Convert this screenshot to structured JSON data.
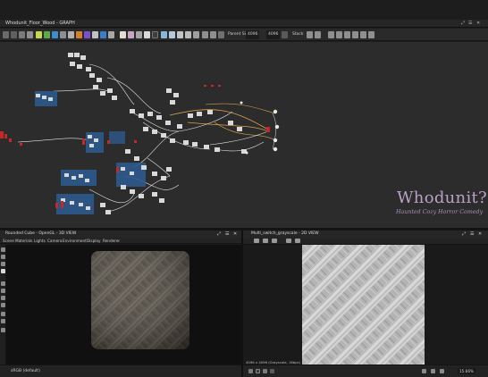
{
  "graph_panel": {
    "title": "Whodunit_Floor_Wood - GRAPH",
    "parent_size_label": "Parent Size:",
    "parent_size_value": "4096",
    "size_value": "4096",
    "blend_label": "Stack",
    "watermark_title": "Whodunit?",
    "watermark_subtitle": "Haunted Cozy Horror Comedy"
  },
  "view3d": {
    "title": "Rounded Cube - OpenGL - 3D VIEW",
    "menu": [
      "Scene",
      "Materials",
      "Lights",
      "Camera",
      "Environment",
      "Display",
      "Renderer"
    ],
    "status_value": "sRGB (default)"
  },
  "view2d": {
    "title": "Multi_switch_grayscale - 2D VIEW",
    "texture_info": "4096 x 4096 (Grayscale, 16bpc)",
    "zoom": "15.66%"
  },
  "colors": {
    "node_blue": "#2e5a8e",
    "node_body": "#d9d9d9",
    "wire_white": "#e8e8e8",
    "wire_orange": "#d9a14a",
    "node_red": "#c62828",
    "watermark": "#b9a0c7"
  },
  "icons": [
    "close-icon",
    "float-icon",
    "menu-icon",
    "camera-icon",
    "grid-icon",
    "zoom-icon",
    "lock-icon"
  ]
}
